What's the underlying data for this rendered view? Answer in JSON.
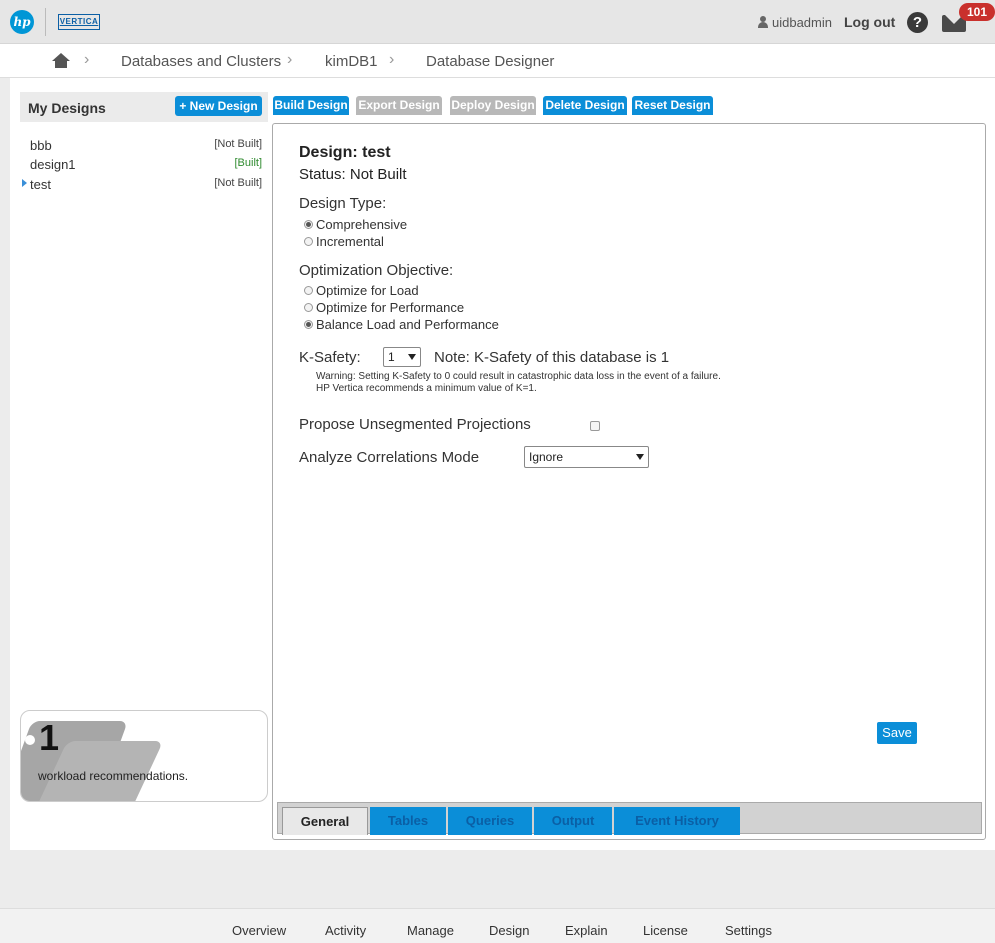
{
  "header": {
    "hp_logo": "hp",
    "vertica_logo": "VERTICA",
    "username": "uidbadmin",
    "logout_label": "Log out",
    "help_label": "?",
    "mail_count": "101"
  },
  "breadcrumb": {
    "items": [
      "Databases and Clusters",
      "kimDB1",
      "Database Designer"
    ],
    "separator": "›"
  },
  "sidebar": {
    "title": "My Designs",
    "new_design_label": "+ New Design",
    "designs": [
      {
        "name": "bbb",
        "status": "[Not Built]"
      },
      {
        "name": "design1",
        "status": "[Built]"
      },
      {
        "name": "test",
        "status": "[Not Built]"
      }
    ],
    "recommendations": {
      "count": "1",
      "label": "workload recommendations."
    }
  },
  "actions": {
    "build": "Build Design",
    "export": "Export Design",
    "deploy": "Deploy Design",
    "delete": "Delete Design",
    "reset": "Reset Design"
  },
  "design": {
    "title": "Design: test",
    "status": "Status: Not Built",
    "design_type_label": "Design Type:",
    "design_type_options": [
      "Comprehensive",
      "Incremental"
    ],
    "optimization_label": "Optimization Objective:",
    "optimization_options": [
      "Optimize for Load",
      "Optimize for Performance",
      "Balance Load and Performance"
    ],
    "ksafety_label": "K-Safety:",
    "ksafety_value": "1",
    "ksafety_note": "Note: K-Safety of this database is 1",
    "warning_line1": "Warning: Setting K-Safety to 0 could result in catastrophic data loss in the event of a failure.",
    "warning_line2": "HP Vertica recommends a minimum value of K=1.",
    "unsegmented_label": "Propose Unsegmented Projections",
    "correlations_label": "Analyze Correlations Mode",
    "correlations_value": "Ignore",
    "save_label": "Save"
  },
  "bottom_tabs": [
    "General",
    "Tables",
    "Queries",
    "Output",
    "Event History"
  ],
  "footer": [
    "Overview",
    "Activity",
    "Manage",
    "Design",
    "Explain",
    "License",
    "Settings"
  ],
  "colors": {
    "accent": "#0b8ed8",
    "disabled": "#b8b8b8",
    "badge": "#c9302c"
  }
}
